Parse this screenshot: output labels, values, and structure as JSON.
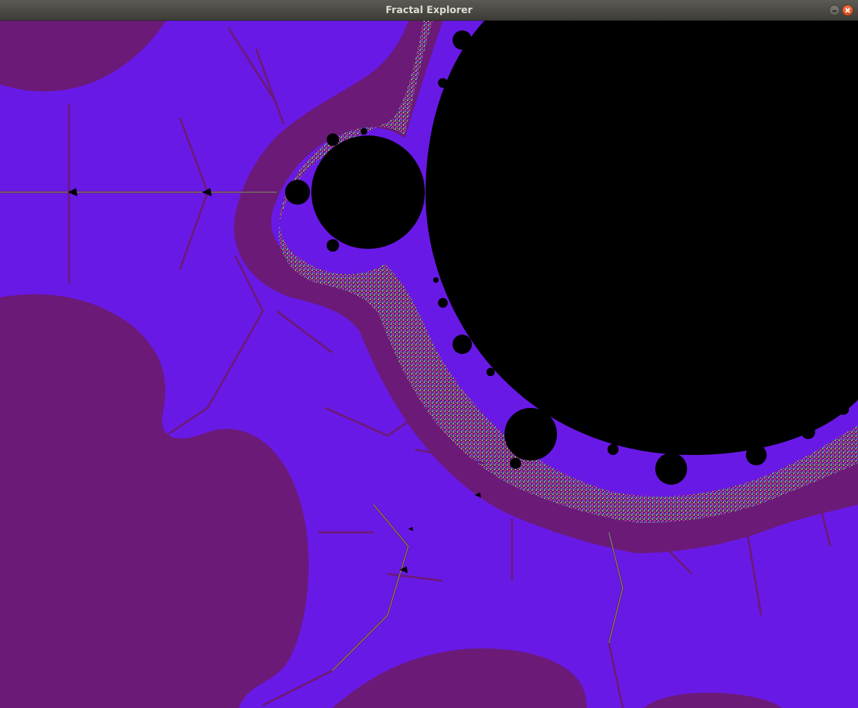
{
  "window": {
    "title": "Fractal Explorer"
  },
  "palette": {
    "interior": "#000000",
    "band_violet": "#6919e6",
    "band_plum": "#6b1a78",
    "filament_green": "#7fd84a",
    "filament_pink": "#e05aa8"
  }
}
